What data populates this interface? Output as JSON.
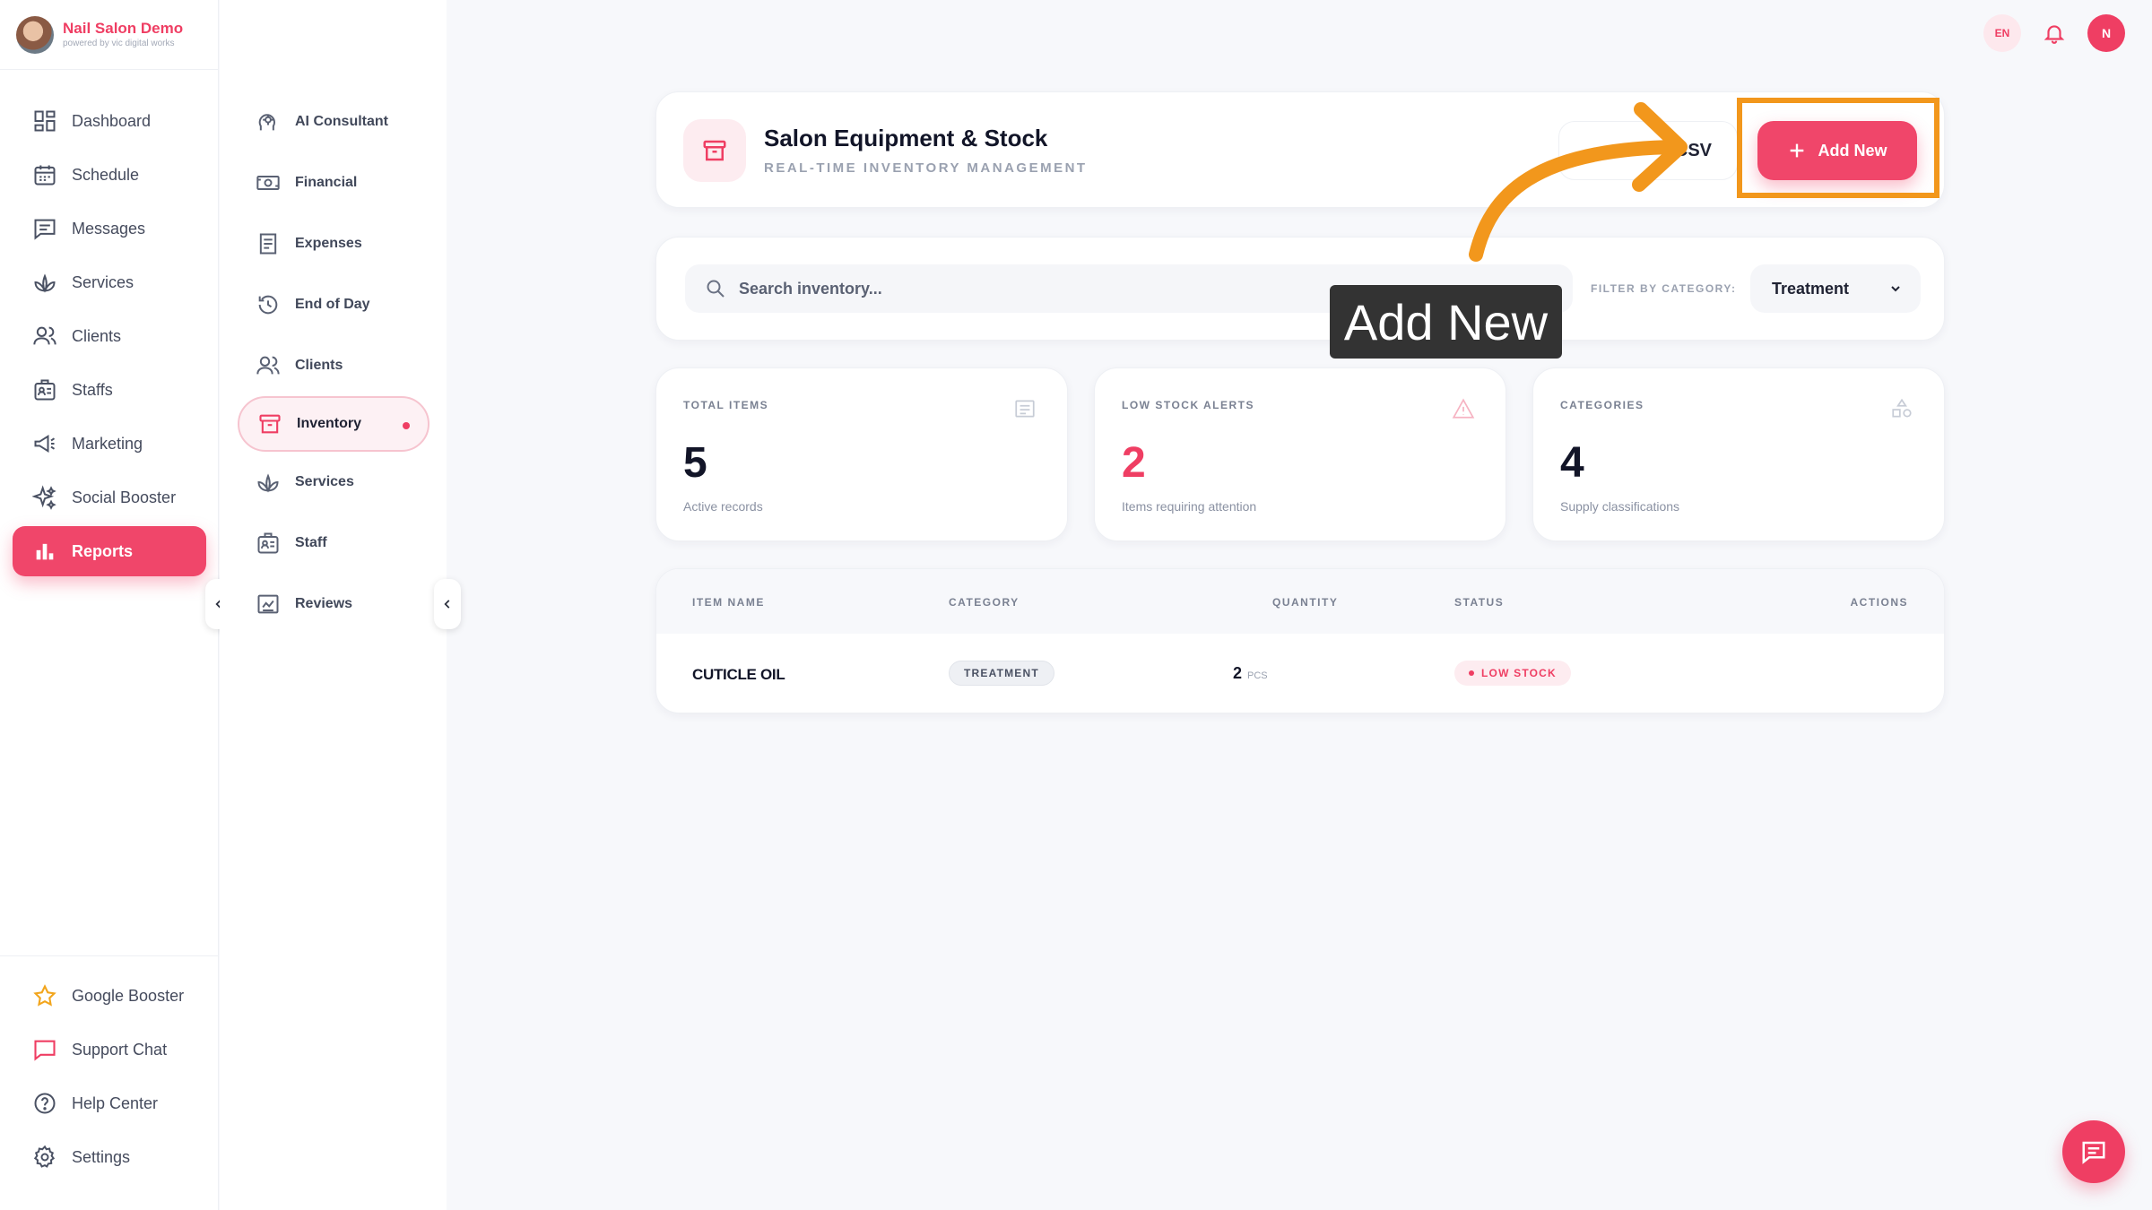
{
  "brand": {
    "title": "Nail Salon Demo",
    "subtitle": "powered by vic digital works"
  },
  "nav": {
    "items": [
      {
        "label": "Dashboard",
        "icon": "dashboard-icon"
      },
      {
        "label": "Schedule",
        "icon": "calendar-icon"
      },
      {
        "label": "Messages",
        "icon": "message-icon"
      },
      {
        "label": "Services",
        "icon": "lotus-icon"
      },
      {
        "label": "Clients",
        "icon": "users-icon"
      },
      {
        "label": "Staffs",
        "icon": "staff-icon"
      },
      {
        "label": "Marketing",
        "icon": "megaphone-icon"
      },
      {
        "label": "Social Booster",
        "icon": "sparkle-icon"
      },
      {
        "label": "Reports",
        "icon": "bar-chart-icon",
        "active": true
      }
    ],
    "bottom": [
      {
        "label": "Google Booster",
        "icon": "star-icon"
      },
      {
        "label": "Support Chat",
        "icon": "chat-icon"
      },
      {
        "label": "Help Center",
        "icon": "help-icon"
      },
      {
        "label": "Settings",
        "icon": "gear-icon"
      }
    ]
  },
  "subnav": {
    "items": [
      {
        "label": "AI Consultant",
        "icon": "ai-icon"
      },
      {
        "label": "Financial",
        "icon": "money-icon"
      },
      {
        "label": "Expenses",
        "icon": "receipt-icon"
      },
      {
        "label": "End of Day",
        "icon": "history-icon"
      },
      {
        "label": "Clients",
        "icon": "users-icon"
      },
      {
        "label": "Inventory",
        "icon": "archive-icon",
        "active": true
      },
      {
        "label": "Services",
        "icon": "lotus-icon"
      },
      {
        "label": "Staff",
        "icon": "staff-icon"
      },
      {
        "label": "Reviews",
        "icon": "review-icon"
      }
    ]
  },
  "topbar": {
    "lang": "EN",
    "avatar_initial": "N"
  },
  "header": {
    "title": "Salon Equipment & Stock",
    "subtitle": "REAL-TIME INVENTORY MANAGEMENT",
    "csv_label": "CSV",
    "add_label": "Add New"
  },
  "filter": {
    "search_placeholder": "Search inventory...",
    "label": "FILTER BY CATEGORY:",
    "selected": "Treatment"
  },
  "tooltip": {
    "text": "Add New"
  },
  "stats": [
    {
      "label": "TOTAL ITEMS",
      "value": "5",
      "note": "Active records",
      "icon": "list-icon"
    },
    {
      "label": "LOW STOCK ALERTS",
      "value": "2",
      "note": "Items requiring attention",
      "icon": "warning-icon"
    },
    {
      "label": "CATEGORIES",
      "value": "4",
      "note": "Supply classifications",
      "icon": "shapes-icon"
    }
  ],
  "table": {
    "columns": [
      "ITEM NAME",
      "CATEGORY",
      "QUANTITY",
      "STATUS",
      "ACTIONS"
    ],
    "rows": [
      {
        "name": "CUTICLE OIL",
        "category": "TREATMENT",
        "qty": "2",
        "unit": "PCS",
        "status": "LOW STOCK"
      }
    ]
  },
  "colors": {
    "accent": "#ef3e63",
    "highlight": "#f2971c",
    "tooltip_bg": "#333333"
  }
}
